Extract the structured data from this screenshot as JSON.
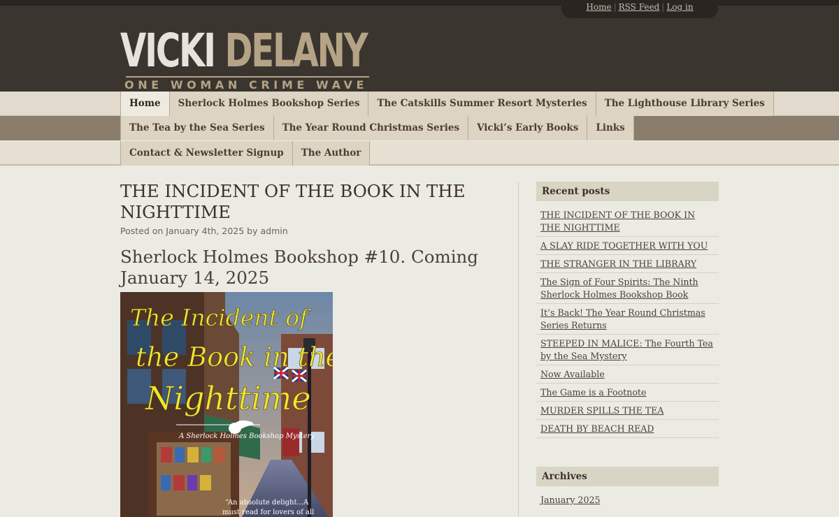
{
  "site": {
    "logo_first": "VICKI",
    "logo_last": "DELANY",
    "tagline": "ONE WOMAN CRIME WAVE"
  },
  "top_links": [
    "Home",
    "RSS Feed",
    "Log in"
  ],
  "nav": {
    "row1": [
      {
        "label": "Home",
        "active": true
      },
      {
        "label": "Sherlock Holmes Bookshop Series"
      },
      {
        "label": "The Catskills Summer Resort Mysteries"
      },
      {
        "label": "The Lighthouse Library Series"
      }
    ],
    "row2": [
      {
        "label": "The Tea by the Sea Series"
      },
      {
        "label": "The Year Round Christmas Series"
      },
      {
        "label": "Vicki’s Early Books"
      },
      {
        "label": "Links"
      }
    ],
    "row3": [
      {
        "label": "Contact & Newsletter Signup"
      },
      {
        "label": "The Author"
      }
    ]
  },
  "post": {
    "title": "THE INCIDENT OF THE BOOK IN THE NIGHTTIME",
    "meta": "Posted on January 4th, 2025 by admin",
    "subtitle": "Sherlock Holmes Bookshop #10. Coming January 14, 2025",
    "cover": {
      "title_line1": "The Incident of",
      "title_line2": "the Book in the",
      "title_line3": "Nighttime",
      "series": "A Sherlock Holmes Bookshop Mystery",
      "blurb_line1": "“An absolute delight...A",
      "blurb_line2": "must read for lovers of all"
    }
  },
  "sidebar": {
    "recent_title": "Recent posts",
    "recent_posts": [
      "THE INCIDENT OF THE BOOK IN THE NIGHTTIME",
      "A SLAY RIDE TOGETHER WITH YOU",
      "THE STRANGER IN THE LIBRARY",
      "The Sign of Four Spirits: The Ninth Sherlock Holmes Bookshop Book",
      "It’s Back! The Year Round Christmas Series Returns",
      "STEEPED IN MALICE: The Fourth Tea by the Sea Mystery",
      "Now Available",
      "The Game is a Footnote",
      "MURDER SPILLS THE TEA",
      "DEATH BY BEACH READ"
    ],
    "archives_title": "Archives",
    "archives": [
      "January 2025"
    ]
  },
  "colors": {
    "header_bg": "#3b3530",
    "logo_light": "#e8e3da",
    "logo_gold": "#b4a385",
    "page_bg": "#ecebe3",
    "nav_dark": "#8b7d6c"
  }
}
